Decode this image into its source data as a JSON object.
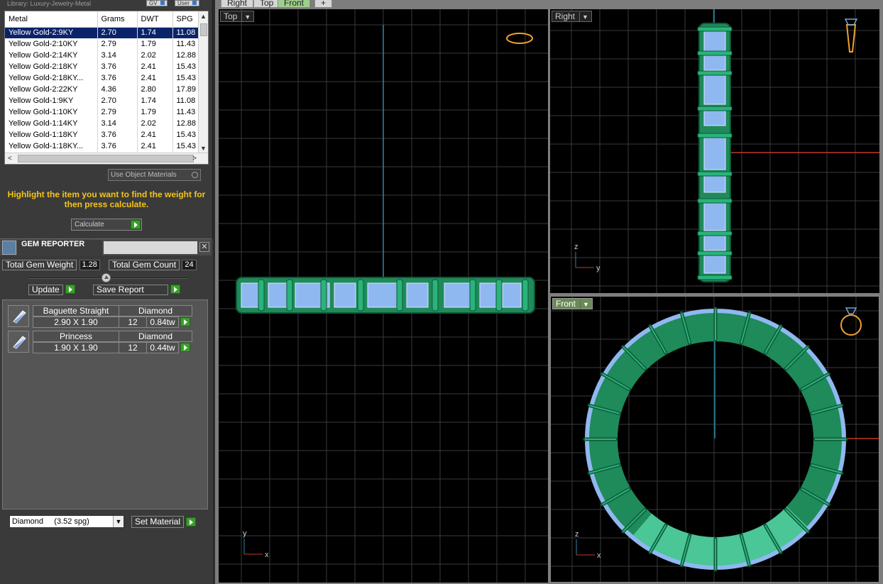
{
  "library": {
    "path_label": "Library: Luxury-Jewelry-Metal",
    "btn_gv": "GV",
    "btn_user": "User"
  },
  "metal_table": {
    "headers": [
      "Metal",
      "Grams",
      "DWT",
      "SPG"
    ],
    "rows": [
      [
        "Yellow Gold-2:9KY",
        "2.70",
        "1.74",
        "11.08"
      ],
      [
        "Yellow Gold-2:10KY",
        "2.79",
        "1.79",
        "11.43"
      ],
      [
        "Yellow Gold-2:14KY",
        "3.14",
        "2.02",
        "12.88"
      ],
      [
        "Yellow Gold-2:18KY",
        "3.76",
        "2.41",
        "15.43"
      ],
      [
        "Yellow Gold-2:18KY...",
        "3.76",
        "2.41",
        "15.43"
      ],
      [
        "Yellow Gold-2:22KY",
        "4.36",
        "2.80",
        "17.89"
      ],
      [
        "Yellow Gold-1:9KY",
        "2.70",
        "1.74",
        "11.08"
      ],
      [
        "Yellow Gold-1:10KY",
        "2.79",
        "1.79",
        "11.43"
      ],
      [
        "Yellow Gold-1:14KY",
        "3.14",
        "2.02",
        "12.88"
      ],
      [
        "Yellow Gold-1:18KY",
        "3.76",
        "2.41",
        "15.43"
      ],
      [
        "Yellow Gold-1:18KY...",
        "3.76",
        "2.41",
        "15.43"
      ]
    ],
    "selected_index": 0
  },
  "use_object_materials": "Use Object Materials",
  "hint": "Highlight the item you want to find the weight for then press calculate.",
  "calculate_label": "Calculate",
  "gem_reporter": {
    "title": "GEM REPORTER",
    "total_weight_label": "Total Gem Weight",
    "total_weight": "1.28",
    "total_count_label": "Total Gem Count",
    "total_count": "24",
    "update_label": "Update",
    "save_label": "Save Report",
    "gems": [
      {
        "shape": "Baguette Straight",
        "material": "Diamond",
        "size": "2.90 X 1.90",
        "count": "12",
        "weight": "0.84tw"
      },
      {
        "shape": "Princess",
        "material": "Diamond",
        "size": "1.90 X 1.90",
        "count": "12",
        "weight": "0.44tw"
      }
    ],
    "material_select": "Diamond     (3.52 spg)",
    "set_material_label": "Set Material"
  },
  "viewport_tabs": [
    "Right",
    "Top",
    "Front",
    "+"
  ],
  "active_tab": "Front",
  "viewports": {
    "top_label": "Top",
    "right_label": "Right",
    "front_label": "Front",
    "axis_x": "x",
    "axis_y": "y",
    "axis_z": "z"
  },
  "colors": {
    "ring_green": "#1f8a5a",
    "gem_blue": "#8fb8f0",
    "grid": "#3a3a3a",
    "accent_yellow": "#f5c518",
    "axis_red": "#c0392b",
    "axis_cyan": "#2a8aa8"
  }
}
